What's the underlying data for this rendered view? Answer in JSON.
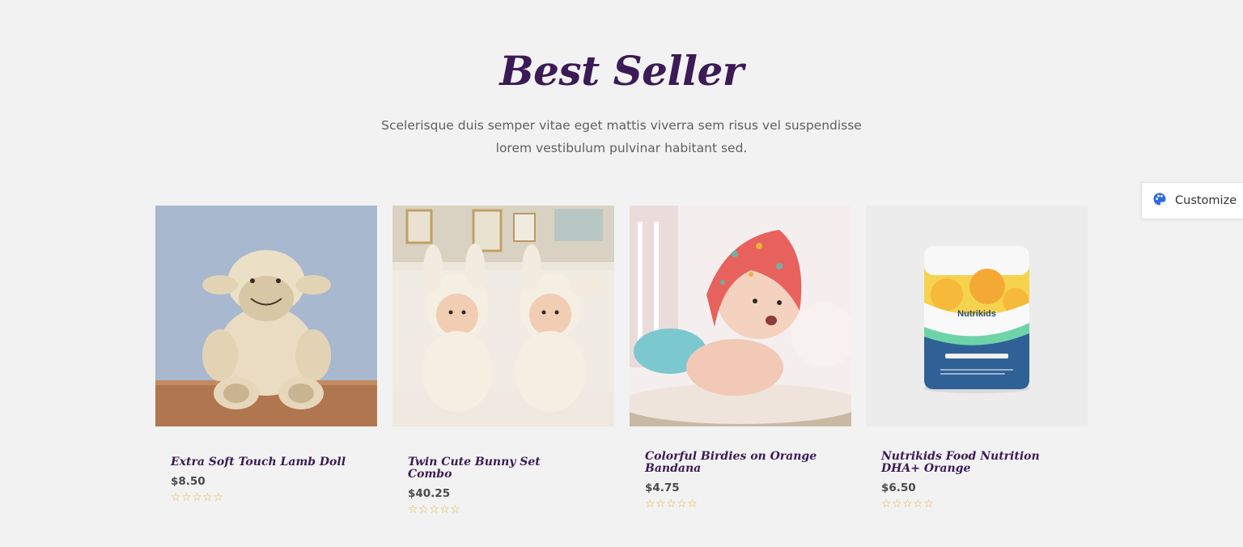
{
  "section": {
    "title": "Best Seller",
    "subtitle": "Scelerisque duis semper vitae eget mattis viverra sem risus vel suspendisse lorem vestibulum pulvinar habitant sed."
  },
  "products": [
    {
      "name": "Extra Soft Touch Lamb Doll",
      "price": "$8.50",
      "stars": "☆☆☆☆☆",
      "rating": 0,
      "image": "lamb-doll-image"
    },
    {
      "name": "Twin Cute Bunny Set Combo",
      "price": "$40.25",
      "stars": "☆☆☆☆☆",
      "rating": 0,
      "image": "twin-bunny-image"
    },
    {
      "name": "Colorful Birdies on Orange Bandana",
      "price": "$4.75",
      "stars": "☆☆☆☆☆",
      "rating": 0,
      "image": "baby-bandana-image"
    },
    {
      "name": "Nutrikids Food Nutrition DHA+ Orange",
      "price": "$6.50",
      "stars": "☆☆☆☆☆",
      "rating": 0,
      "image": "nutrikids-jar-image",
      "jar_label": "Nutrikids"
    }
  ],
  "customize": {
    "label": "Customize",
    "icon": "palette-icon",
    "icon_color": "#2f6be0"
  },
  "colors": {
    "title": "#3b1a55",
    "stars": "#e8b63c",
    "background": "#f2f2f2"
  }
}
